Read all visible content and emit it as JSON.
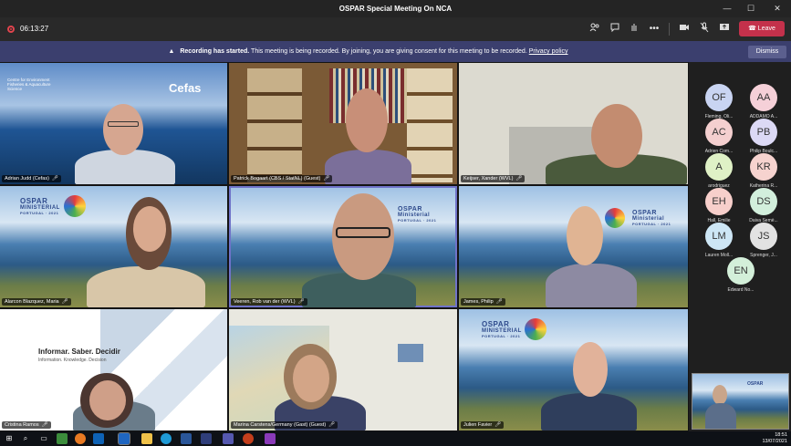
{
  "window": {
    "title": "OSPAR Special Meeting On NCA"
  },
  "toolbar": {
    "timer": "06:13:27",
    "leave_label": "Leave"
  },
  "banner": {
    "title": "Recording has started.",
    "message": "This meeting is being recorded. By joining, you are giving consent for this meeting to be recorded.",
    "link": "Privacy policy",
    "dismiss_label": "Dismiss"
  },
  "tiles": [
    {
      "name": "Adrian Judd (Cefas)",
      "logo_text": "Cefas",
      "org_text": "Centre for Environment Fisheries & Aquaculture Science"
    },
    {
      "name": "Patrick Bogaart (CBS / StatNL) (Guest)"
    },
    {
      "name": "Keijser, Xander (WVL)"
    },
    {
      "name": "Alarcon Blazquez, Maria",
      "logo_line1": "OSPAR",
      "logo_line2": "MINISTERIAL",
      "logo_line3": "PORTUGAL · 2021"
    },
    {
      "name": "Veeren, Rob van der (WVL)",
      "logo_line1": "OSPAR",
      "logo_line2": "Ministerial",
      "logo_line3": "PORTUGAL · 2021"
    },
    {
      "name": "James, Philip",
      "logo_line1": "OSPAR",
      "logo_line2": "Ministerial",
      "logo_line3": "PORTUGAL · 2021"
    },
    {
      "name": "Cristina Ramos",
      "slide_title": "Informar. Saber. Decidir",
      "slide_sub": "Information. Knowledge. Decision"
    },
    {
      "name": "Marina Carstens/Germany (Gast) (Guest)"
    },
    {
      "name": "Julien Favier",
      "logo_line1": "OSPAR",
      "logo_line2": "MINISTERIAL",
      "logo_line3": "PORTUGAL · 2021"
    }
  ],
  "participants": [
    {
      "initials": "OF",
      "name": "Fleming, Oli...",
      "color": "#c9d4f2"
    },
    {
      "initials": "AA",
      "name": "ADDAMO A...",
      "color": "#f5d0d8"
    },
    {
      "initials": "AC",
      "name": "Adrien Com...",
      "color": "#f4cfcf"
    },
    {
      "initials": "PB",
      "name": "Philip Boulc...",
      "color": "#dcd9f5"
    },
    {
      "initials": "A",
      "name": "arodriguez",
      "color": "#dff1c6"
    },
    {
      "initials": "KR",
      "name": "Katherina R...",
      "color": "#f6d3cf"
    },
    {
      "initials": "EH",
      "name": "Hall, Emilie",
      "color": "#f7cfcb"
    },
    {
      "initials": "DS",
      "name": "Daiva Semè...",
      "color": "#d2efdc"
    },
    {
      "initials": "LM",
      "name": "Lauren Moll...",
      "color": "#cde6f5"
    },
    {
      "initials": "JS",
      "name": "Sprenger, J...",
      "color": "#e2e2e2"
    },
    {
      "initials": "EN",
      "name": "Edward No...",
      "color": "#d3efd9"
    }
  ],
  "taskbar": {
    "time": "18:51",
    "date": "13/07/2021"
  },
  "colors": {
    "accent": "#6f73c9",
    "leave": "#c4314b",
    "banner": "#3b3f6e"
  }
}
